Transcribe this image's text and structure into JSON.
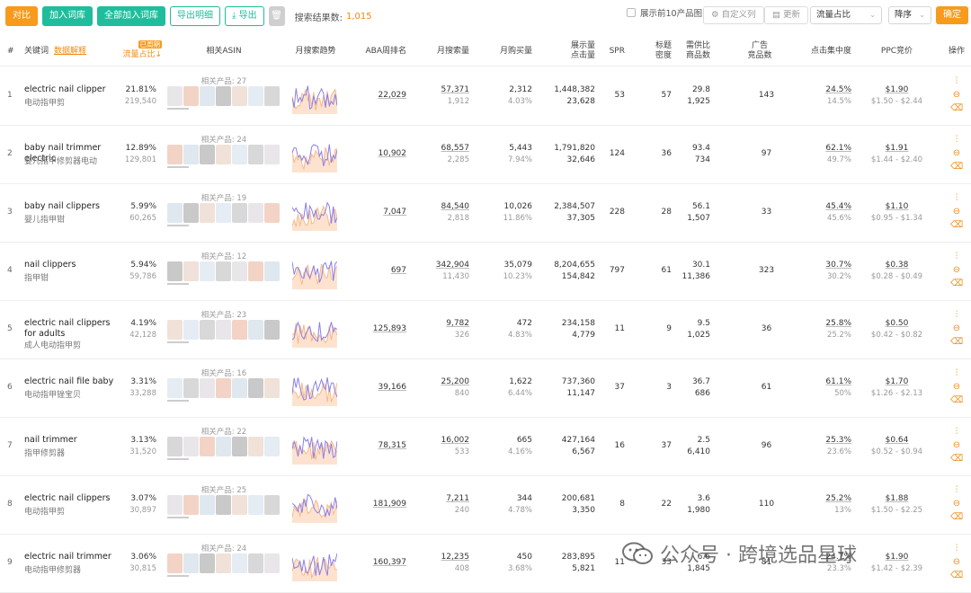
{
  "toolbar": {
    "compare": "对比",
    "add_to_lib": "加入词库",
    "add_all_to_lib": "全部加入词库",
    "export_detail": "导出明细",
    "export": "导出",
    "result_label": "搜索结果数:",
    "result_count": "1,015",
    "show_top10": "展示前10产品图",
    "custom_columns": "自定义列",
    "settings": "更新",
    "sort_field": "流量占比",
    "sort_order": "降序",
    "confirm": "确定"
  },
  "header": {
    "idx": "#",
    "keyword": "关键词",
    "data_explain": "数据解释",
    "traffic_tag": "已周期",
    "traffic_share": "流量占比↓",
    "related_asin": "相关ASIN",
    "monthly_trend": "月搜索趋势",
    "aba_rank": "ABA周排名",
    "monthly_search": "月搜索量",
    "monthly_buy": "月购买量",
    "impressions_clicks_1": "展示量",
    "impressions_clicks_2": "点击量",
    "spr": "SPR",
    "title_density_1": "标题",
    "title_density_2": "密度",
    "supply_demand_1": "需供比",
    "supply_demand_2": "商品数",
    "ad_products_1": "广告",
    "ad_products_2": "竞品数",
    "click_concentration": "点击集中度",
    "ppc_bid": "PPC竞价",
    "ops": "操作"
  },
  "rows": [
    {
      "idx": "1",
      "kw": "electric nail clipper",
      "cn": "电动指甲剪",
      "share": "21.81%",
      "share_sub": "219,540",
      "rel": "相关产品: 27",
      "aba": "22,029",
      "search": "57,371",
      "search_sub": "1,912",
      "buy": "2,312",
      "buy_sub": "4.03%",
      "imp": "1,448,382",
      "clk": "23,628",
      "spr": "53",
      "density": "57",
      "sd": "29.8",
      "sd_sub": "1,925",
      "ads": "143",
      "conc": "24.5%",
      "conc_sub": "14.5%",
      "ppc": "$1.90",
      "ppc_range": "$1.50 - $2.44",
      "trend_seed": 1
    },
    {
      "idx": "2",
      "kw": "baby nail trimmer electric",
      "cn": "婴儿指甲修剪器电动",
      "share": "12.89%",
      "share_sub": "129,801",
      "rel": "相关产品: 24",
      "aba": "10,902",
      "search": "68,557",
      "search_sub": "2,285",
      "buy": "5,443",
      "buy_sub": "7.94%",
      "imp": "1,791,820",
      "clk": "32,646",
      "spr": "124",
      "density": "36",
      "sd": "93.4",
      "sd_sub": "734",
      "ads": "97",
      "conc": "62.1%",
      "conc_sub": "49.7%",
      "ppc": "$1.91",
      "ppc_range": "$1.44 - $2.40",
      "trend_seed": 2
    },
    {
      "idx": "3",
      "kw": "baby nail clippers",
      "cn": "婴儿指甲钳",
      "share": "5.99%",
      "share_sub": "60,265",
      "rel": "相关产品: 19",
      "aba": "7,047",
      "search": "84,540",
      "search_sub": "2,818",
      "buy": "10,026",
      "buy_sub": "11.86%",
      "imp": "2,384,507",
      "clk": "37,305",
      "spr": "228",
      "density": "28",
      "sd": "56.1",
      "sd_sub": "1,507",
      "ads": "33",
      "conc": "45.4%",
      "conc_sub": "45.6%",
      "ppc": "$1.10",
      "ppc_range": "$0.95 - $1.34",
      "trend_seed": 3
    },
    {
      "idx": "4",
      "kw": "nail clippers",
      "cn": "指甲钳",
      "share": "5.94%",
      "share_sub": "59,786",
      "rel": "相关产品: 12",
      "aba": "697",
      "search": "342,904",
      "search_sub": "11,430",
      "buy": "35,079",
      "buy_sub": "10.23%",
      "imp": "8,204,655",
      "clk": "154,842",
      "spr": "797",
      "density": "61",
      "sd": "30.1",
      "sd_sub": "11,386",
      "ads": "323",
      "conc": "30.7%",
      "conc_sub": "30.2%",
      "ppc": "$0.38",
      "ppc_range": "$0.28 - $0.49",
      "trend_seed": 4
    },
    {
      "idx": "5",
      "kw": "electric nail clippers for adults",
      "cn": "成人电动指甲剪",
      "share": "4.19%",
      "share_sub": "42,128",
      "rel": "相关产品: 23",
      "aba": "125,893",
      "search": "9,782",
      "search_sub": "326",
      "buy": "472",
      "buy_sub": "4.83%",
      "imp": "234,158",
      "clk": "4,779",
      "spr": "11",
      "density": "9",
      "sd": "9.5",
      "sd_sub": "1,025",
      "ads": "36",
      "conc": "25.8%",
      "conc_sub": "25.2%",
      "ppc": "$0.50",
      "ppc_range": "$0.42 - $0.82",
      "trend_seed": 5
    },
    {
      "idx": "6",
      "kw": "electric nail file baby",
      "cn": "电动指甲锉宝贝",
      "share": "3.31%",
      "share_sub": "33,288",
      "rel": "相关产品: 16",
      "aba": "39,166",
      "search": "25,200",
      "search_sub": "840",
      "buy": "1,622",
      "buy_sub": "6.44%",
      "imp": "737,360",
      "clk": "11,147",
      "spr": "37",
      "density": "3",
      "sd": "36.7",
      "sd_sub": "686",
      "ads": "61",
      "conc": "61.1%",
      "conc_sub": "50%",
      "ppc": "$1.70",
      "ppc_range": "$1.26 - $2.13",
      "trend_seed": 6
    },
    {
      "idx": "7",
      "kw": "nail trimmer",
      "cn": "指甲修剪器",
      "share": "3.13%",
      "share_sub": "31,520",
      "rel": "相关产品: 22",
      "aba": "78,315",
      "search": "16,002",
      "search_sub": "533",
      "buy": "665",
      "buy_sub": "4.16%",
      "imp": "427,164",
      "clk": "6,567",
      "spr": "16",
      "density": "37",
      "sd": "2.5",
      "sd_sub": "6,410",
      "ads": "96",
      "conc": "25.3%",
      "conc_sub": "23.6%",
      "ppc": "$0.64",
      "ppc_range": "$0.52 - $0.94",
      "trend_seed": 7
    },
    {
      "idx": "8",
      "kw": "electric nail clippers",
      "cn": "电动指甲剪",
      "share": "3.07%",
      "share_sub": "30,897",
      "rel": "相关产品: 25",
      "aba": "181,909",
      "search": "7,211",
      "search_sub": "240",
      "buy": "344",
      "buy_sub": "4.78%",
      "imp": "200,681",
      "clk": "3,350",
      "spr": "8",
      "density": "22",
      "sd": "3.6",
      "sd_sub": "1,980",
      "ads": "110",
      "conc": "25.2%",
      "conc_sub": "13%",
      "ppc": "$1.88",
      "ppc_range": "$1.50 - $2.25",
      "trend_seed": 8
    },
    {
      "idx": "9",
      "kw": "electric nail trimmer",
      "cn": "电动指甲修剪器",
      "share": "3.06%",
      "share_sub": "30,815",
      "rel": "相关产品: 24",
      "aba": "160,397",
      "search": "12,235",
      "search_sub": "408",
      "buy": "450",
      "buy_sub": "3.68%",
      "imp": "283,895",
      "clk": "5,821",
      "spr": "11",
      "density": "33",
      "sd": "6.6",
      "sd_sub": "1,845",
      "ads": "81",
      "conc": "24.7%",
      "conc_sub": "23.3%",
      "ppc": "$1.90",
      "ppc_range": "$1.42 - $2.39",
      "trend_seed": 9
    }
  ],
  "watermark": "公众号 · 跨境选品星球",
  "colors": {
    "accent": "#f89a1c",
    "teal": "#1fbd9c",
    "trend_purple": "#8b7fe8",
    "trend_orange": "#f6b98a"
  }
}
